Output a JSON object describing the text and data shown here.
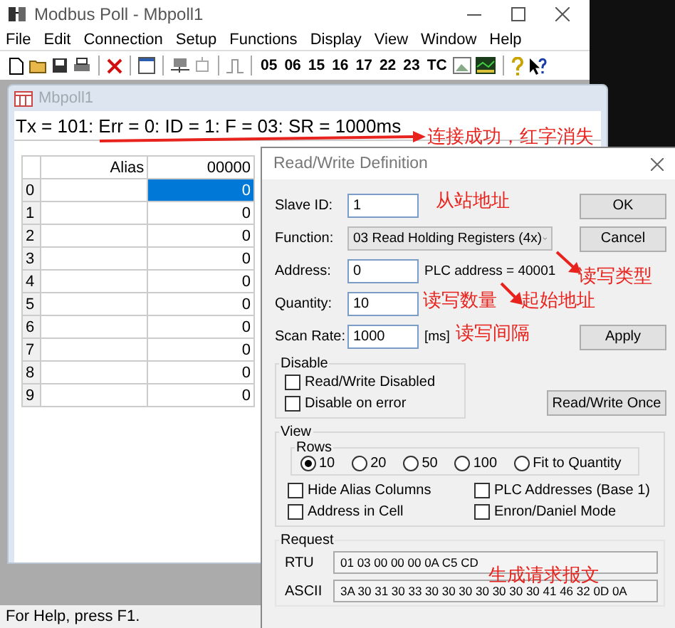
{
  "app": {
    "title": "Modbus Poll - Mbpoll1"
  },
  "menu": [
    "File",
    "Edit",
    "Connection",
    "Setup",
    "Functions",
    "Display",
    "View",
    "Window",
    "Help"
  ],
  "toolbar": {
    "buttons": [
      "05",
      "06",
      "15",
      "16",
      "17",
      "22",
      "23",
      "TC"
    ]
  },
  "child_window": {
    "title": "Mbpoll1",
    "status_line": "Tx = 101: Err = 0: ID = 1: F = 03: SR = 1000ms",
    "grid": {
      "columns": [
        "Alias",
        "00000"
      ],
      "rows": [
        {
          "row": "0",
          "value": "0",
          "selected": true
        },
        {
          "row": "1",
          "value": "0",
          "selected": false
        },
        {
          "row": "2",
          "value": "0",
          "selected": false
        },
        {
          "row": "3",
          "value": "0",
          "selected": false
        },
        {
          "row": "4",
          "value": "0",
          "selected": false
        },
        {
          "row": "5",
          "value": "0",
          "selected": false
        },
        {
          "row": "6",
          "value": "0",
          "selected": false
        },
        {
          "row": "7",
          "value": "0",
          "selected": false
        },
        {
          "row": "8",
          "value": "0",
          "selected": false
        },
        {
          "row": "9",
          "value": "0",
          "selected": false
        }
      ]
    }
  },
  "dialog": {
    "title": "Read/Write Definition",
    "fields": [
      {
        "label": "Slave ID:",
        "kind": "input",
        "value": "1"
      },
      {
        "label": "Function:",
        "kind": "combo",
        "value": "03 Read Holding Registers (4x)"
      },
      {
        "label": "Address:",
        "kind": "input",
        "value": "0",
        "note": "PLC address = 40001"
      },
      {
        "label": "Quantity:",
        "kind": "input",
        "value": "10"
      },
      {
        "label": "Scan Rate:",
        "kind": "input",
        "value": "1000",
        "note": "[ms]"
      }
    ],
    "buttons": [
      "OK",
      "Cancel",
      "Apply"
    ],
    "disable_group": {
      "title": "Disable",
      "options": [
        {
          "label": "Read/Write Disabled",
          "checked": false
        },
        {
          "label": "Disable on error",
          "checked": false
        }
      ]
    },
    "once_button": "Read/Write Once",
    "view_group": {
      "title": "View",
      "rows_title": "Rows",
      "rows": [
        {
          "label": "10",
          "selected": true
        },
        {
          "label": "20",
          "selected": false
        },
        {
          "label": "50",
          "selected": false
        },
        {
          "label": "100",
          "selected": false
        },
        {
          "label": "Fit to Quantity",
          "selected": false
        }
      ],
      "options": [
        {
          "label": "Hide Alias Columns",
          "checked": false
        },
        {
          "label": "PLC Addresses (Base 1)",
          "checked": false
        },
        {
          "label": "Address in Cell",
          "checked": false
        },
        {
          "label": "Enron/Daniel Mode",
          "checked": false
        }
      ]
    },
    "request": {
      "title": "Request",
      "rtu_label": "RTU",
      "rtu": "01 03 00 00 00 0A C5 CD",
      "ascii_label": "ASCII",
      "ascii": "3A 30 31 30 33 30 30 30 30 30 30 30 41 46 32 0D 0A"
    }
  },
  "annotations": [
    {
      "text": "连接成功，红字消失"
    },
    {
      "text": "从站地址"
    },
    {
      "text": "读写类型"
    },
    {
      "text": "起始地址"
    },
    {
      "text": "读写数量"
    },
    {
      "text": "读写间隔"
    },
    {
      "text": "生成请求报文"
    }
  ],
  "status_bar": "For Help, press F1."
}
